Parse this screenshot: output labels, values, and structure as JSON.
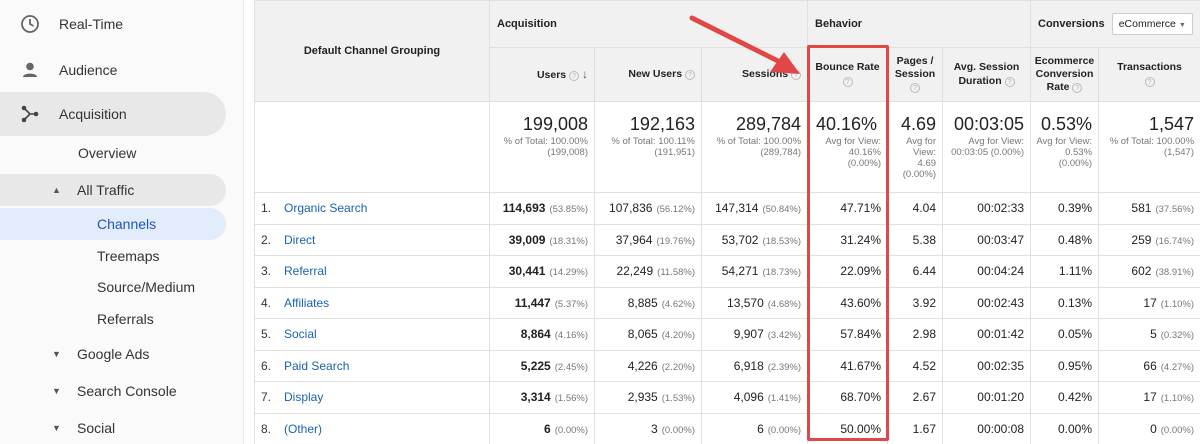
{
  "sidebar": {
    "main": [
      {
        "label": "Real-Time",
        "icon": "clock-icon"
      },
      {
        "label": "Audience",
        "icon": "person-icon"
      },
      {
        "label": "Acquisition",
        "icon": "acquisition-icon"
      }
    ],
    "sub": [
      {
        "label": "Overview"
      },
      {
        "label": "All Traffic"
      },
      {
        "label": "Channels"
      },
      {
        "label": "Treemaps"
      },
      {
        "label": "Source/Medium"
      },
      {
        "label": "Referrals"
      },
      {
        "label": "Google Ads"
      },
      {
        "label": "Search Console"
      },
      {
        "label": "Social"
      }
    ]
  },
  "table": {
    "dimension_header": "Default Channel Grouping",
    "groups": {
      "acquisition": "Acquisition",
      "behavior": "Behavior",
      "conversions": "Conversions"
    },
    "conversion_select": "eCommerce",
    "columns": {
      "users": "Users",
      "new_users": "New Users",
      "sessions": "Sessions",
      "bounce_rate": "Bounce Rate",
      "pages_session": "Pages / Session",
      "avg_duration": "Avg. Session Duration",
      "ecom_rate": "Ecommerce Conversion Rate",
      "transactions": "Transactions"
    },
    "totals": {
      "users": {
        "value": "199,008",
        "sub": "% of Total: 100.00% (199,008)"
      },
      "new_users": {
        "value": "192,163",
        "sub": "% of Total: 100.11% (191,951)"
      },
      "sessions": {
        "value": "289,784",
        "sub": "% of Total: 100.00% (289,784)"
      },
      "bounce_rate": {
        "value": "40.16%",
        "sub": "Avg for View: 40.16% (0.00%)"
      },
      "pages_session": {
        "value": "4.69",
        "sub": "Avg for View: 4.69 (0.00%)"
      },
      "avg_duration": {
        "value": "00:03:05",
        "sub": "Avg for View: 00:03:05 (0.00%)"
      },
      "ecom_rate": {
        "value": "0.53%",
        "sub": "Avg for View: 0.53% (0.00%)"
      },
      "transactions": {
        "value": "1,547",
        "sub": "% of Total: 100.00% (1,547)"
      }
    },
    "rows": [
      {
        "idx": "1.",
        "name": "Organic Search",
        "users": "114,693",
        "users_pct": "(53.85%)",
        "new_users": "107,836",
        "new_users_pct": "(56.12%)",
        "sessions": "147,314",
        "sessions_pct": "(50.84%)",
        "bounce": "47.71%",
        "pages": "4.04",
        "duration": "00:02:33",
        "ecom": "0.39%",
        "trans": "581",
        "trans_pct": "(37.56%)"
      },
      {
        "idx": "2.",
        "name": "Direct",
        "users": "39,009",
        "users_pct": "(18.31%)",
        "new_users": "37,964",
        "new_users_pct": "(19.76%)",
        "sessions": "53,702",
        "sessions_pct": "(18.53%)",
        "bounce": "31.24%",
        "pages": "5.38",
        "duration": "00:03:47",
        "ecom": "0.48%",
        "trans": "259",
        "trans_pct": "(16.74%)"
      },
      {
        "idx": "3.",
        "name": "Referral",
        "users": "30,441",
        "users_pct": "(14.29%)",
        "new_users": "22,249",
        "new_users_pct": "(11.58%)",
        "sessions": "54,271",
        "sessions_pct": "(18.73%)",
        "bounce": "22.09%",
        "pages": "6.44",
        "duration": "00:04:24",
        "ecom": "1.11%",
        "trans": "602",
        "trans_pct": "(38.91%)"
      },
      {
        "idx": "4.",
        "name": "Affiliates",
        "users": "11,447",
        "users_pct": "(5.37%)",
        "new_users": "8,885",
        "new_users_pct": "(4.62%)",
        "sessions": "13,570",
        "sessions_pct": "(4.68%)",
        "bounce": "43.60%",
        "pages": "3.92",
        "duration": "00:02:43",
        "ecom": "0.13%",
        "trans": "17",
        "trans_pct": "(1.10%)"
      },
      {
        "idx": "5.",
        "name": "Social",
        "users": "8,864",
        "users_pct": "(4.16%)",
        "new_users": "8,065",
        "new_users_pct": "(4.20%)",
        "sessions": "9,907",
        "sessions_pct": "(3.42%)",
        "bounce": "57.84%",
        "pages": "2.98",
        "duration": "00:01:42",
        "ecom": "0.05%",
        "trans": "5",
        "trans_pct": "(0.32%)"
      },
      {
        "idx": "6.",
        "name": "Paid Search",
        "users": "5,225",
        "users_pct": "(2.45%)",
        "new_users": "4,226",
        "new_users_pct": "(2.20%)",
        "sessions": "6,918",
        "sessions_pct": "(2.39%)",
        "bounce": "41.67%",
        "pages": "4.52",
        "duration": "00:02:35",
        "ecom": "0.95%",
        "trans": "66",
        "trans_pct": "(4.27%)"
      },
      {
        "idx": "7.",
        "name": "Display",
        "users": "3,314",
        "users_pct": "(1.56%)",
        "new_users": "2,935",
        "new_users_pct": "(1.53%)",
        "sessions": "4,096",
        "sessions_pct": "(1.41%)",
        "bounce": "68.70%",
        "pages": "2.67",
        "duration": "00:01:20",
        "ecom": "0.42%",
        "trans": "17",
        "trans_pct": "(1.10%)"
      },
      {
        "idx": "8.",
        "name": "(Other)",
        "users": "6",
        "users_pct": "(0.00%)",
        "new_users": "3",
        "new_users_pct": "(0.00%)",
        "sessions": "6",
        "sessions_pct": "(0.00%)",
        "bounce": "50.00%",
        "pages": "1.67",
        "duration": "00:00:08",
        "ecom": "0.00%",
        "trans": "0",
        "trans_pct": "(0.00%)"
      }
    ]
  },
  "colors": {
    "annotation": "#e04848",
    "link": "#1a62b0",
    "selected": "#1a57c4"
  }
}
